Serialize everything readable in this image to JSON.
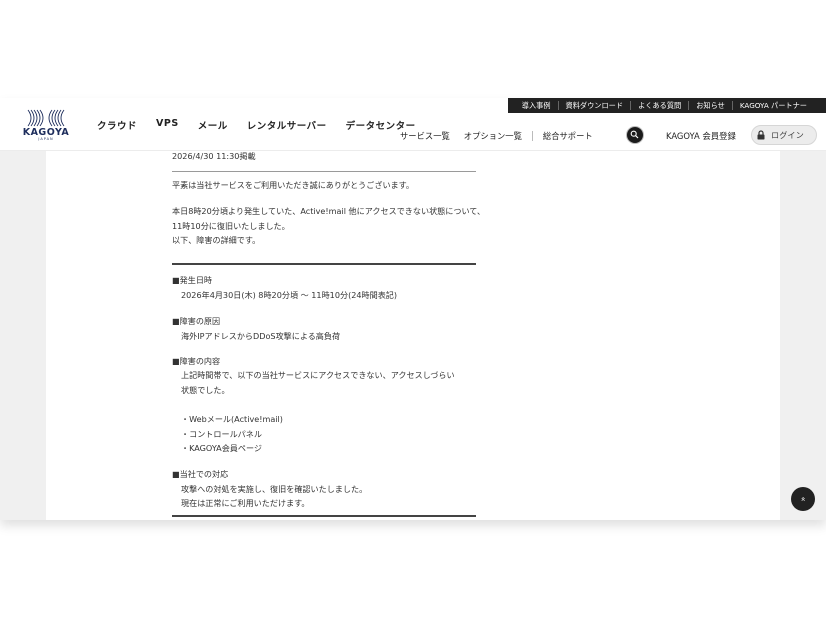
{
  "topbar": {
    "links": [
      "導入事例",
      "資料ダウンロード",
      "よくある質問",
      "お知らせ",
      "KAGOYA パートナー"
    ]
  },
  "logo": {
    "word": "KAGOYA",
    "sub": "JAPAN"
  },
  "mainnav": {
    "items": [
      "クラウド",
      "VPS",
      "メール",
      "レンタルサーバー",
      "データセンター"
    ]
  },
  "subnav": {
    "services": "サービス一覧",
    "options": "オプション一覧",
    "support": "総合サポート"
  },
  "header": {
    "member_register": "KAGOYA 会員登録",
    "login": "ログイン"
  },
  "article": {
    "posted": "2026/4/30 11:30掲載",
    "greeting": "平素は当社サービスをご利用いただき誠にありがとうございます。",
    "intro1": "本日8時20分頃より発生していた、Active!mail 他にアクセスできない状態について、",
    "intro2": "11時10分に復旧いたしました。",
    "intro3": "以下、障害の詳細です。",
    "h_when": "■発生日時",
    "when": "2026年4月30日(木) 8時20分頃 ～ 11時10分(24時間表記)",
    "h_cause": "■障害の原因",
    "cause": "海外IPアドレスからDDoS攻撃による高負荷",
    "h_detail": "■障害の内容",
    "detail1": "上記時間帯で、以下の当社サービスにアクセスできない、アクセスしづらい",
    "detail2": "状態でした。",
    "item1": "・Webメール(Active!mail)",
    "item2": "・コントロールパネル",
    "item3": "・KAGOYA会員ページ",
    "h_response": "■当社での対応",
    "response1": "攻撃への対処を実施し、復旧を確認いたしました。",
    "response2": "現在は正常にご利用いただけます。"
  },
  "colors": {
    "header_bar": "#222222",
    "text": "#333333",
    "logo": "#1d2d5c"
  },
  "icons": {
    "search": "search-icon",
    "login": "lock-icon",
    "totop": "chevron-double-up-icon"
  },
  "totop": {
    "label": "»"
  }
}
